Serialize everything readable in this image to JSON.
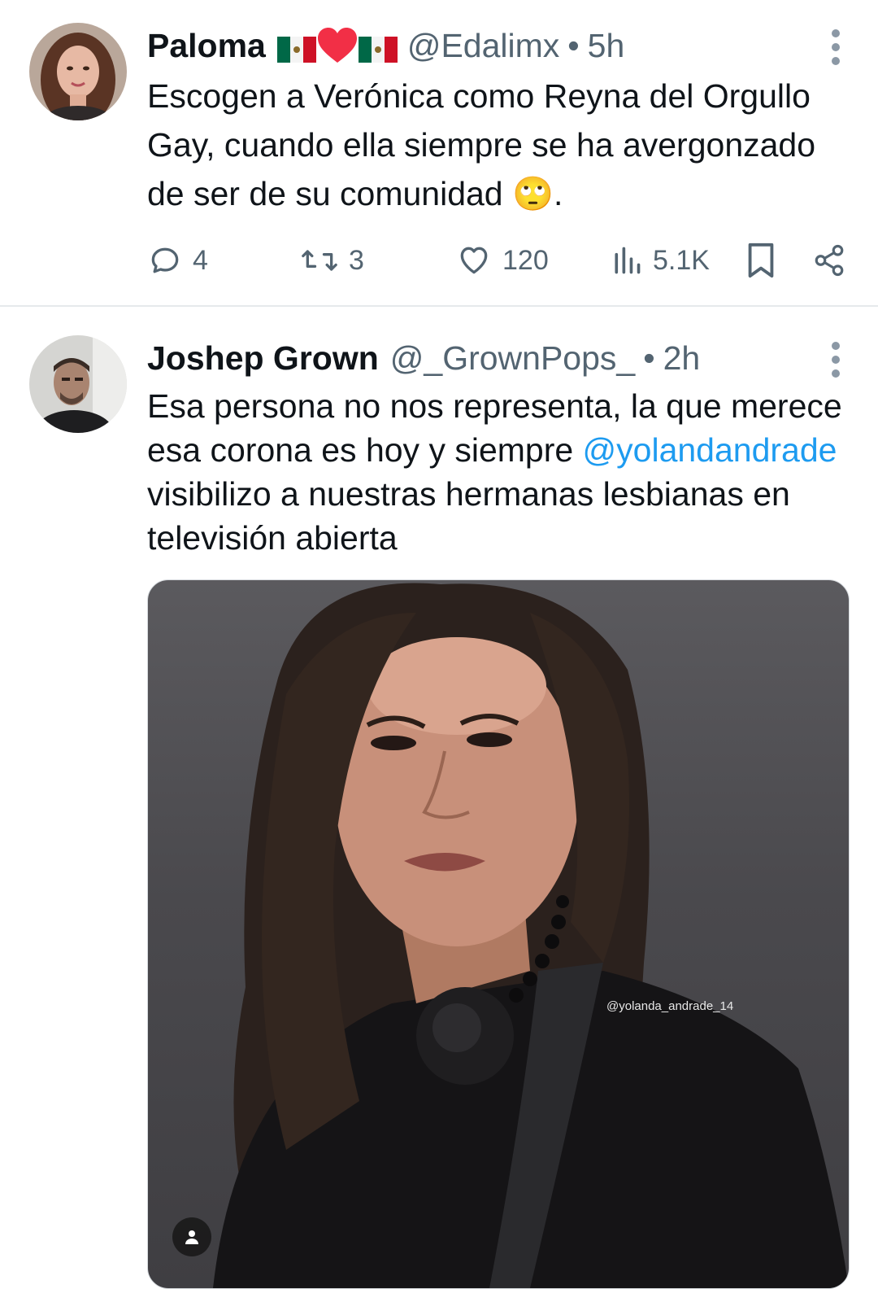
{
  "tweets": [
    {
      "name": "Paloma",
      "handle": "@Edalimx",
      "separator": "•",
      "time": "5h",
      "text": "Escogen a Verónica como Reyna del Orgullo Gay, cuando ella siempre se ha avergonzado de ser de su comunidad 🙄.",
      "name_emojis": [
        "mexico-flag",
        "red-heart",
        "mexico-flag"
      ],
      "actions": {
        "replies": "4",
        "reposts": "3",
        "likes": "120",
        "views": "5.1K"
      }
    },
    {
      "name": "Joshep Grown",
      "handle": "@_GrownPops_",
      "separator": "•",
      "time": "2h",
      "text_before": "Esa persona no nos representa, la que merece esa corona es hoy y siempre ",
      "mention": "@yolandandrade",
      "text_after": " visibilizo a nuestras hermanas lesbianas en televisión abierta",
      "media": {
        "watermark": "@yolanda_andrade_14",
        "description_icon": "person-icon"
      }
    }
  ],
  "colors": {
    "text_primary": "#0f1419",
    "text_secondary": "#536471",
    "link": "#1d9bf0",
    "divider": "#e6e9ec"
  }
}
